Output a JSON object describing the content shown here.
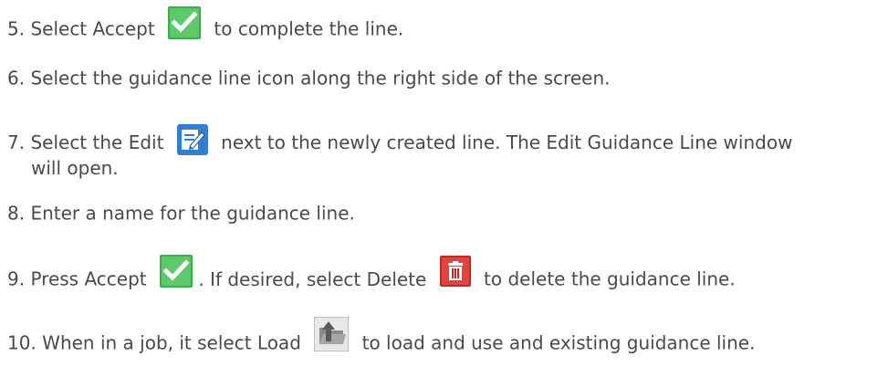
{
  "steps": [
    {
      "num": "5.",
      "before": "Select Accept",
      "icon": "accept-checkmark-icon",
      "after": "to complete the line."
    },
    {
      "num": "6.",
      "text": "Select the guidance line icon along the right side of the screen."
    },
    {
      "num": "7.",
      "before": "Select the Edit",
      "icon": "edit-pencil-icon",
      "after": "next to the newly created line. The Edit Guidance Line window",
      "continuation": "will open."
    },
    {
      "num": "8.",
      "text": "Enter a name for the guidance line."
    },
    {
      "num": "9.",
      "before": "Press Accept",
      "icon1": "accept-checkmark-icon",
      "middle": ". If desired, select Delete",
      "icon2": "delete-trash-icon",
      "after": "to delete the guidance line."
    },
    {
      "num": "10.",
      "before": "When in a job, it select Load",
      "icon": "load-folder-icon",
      "after": "to load and use and existing guidance line."
    }
  ],
  "colors": {
    "text": "#4a4a4a",
    "accept_green": "#33b24a",
    "edit_blue": "#2f7fd6",
    "delete_red": "#d0342c",
    "load_gray": "#8a8a8a"
  }
}
